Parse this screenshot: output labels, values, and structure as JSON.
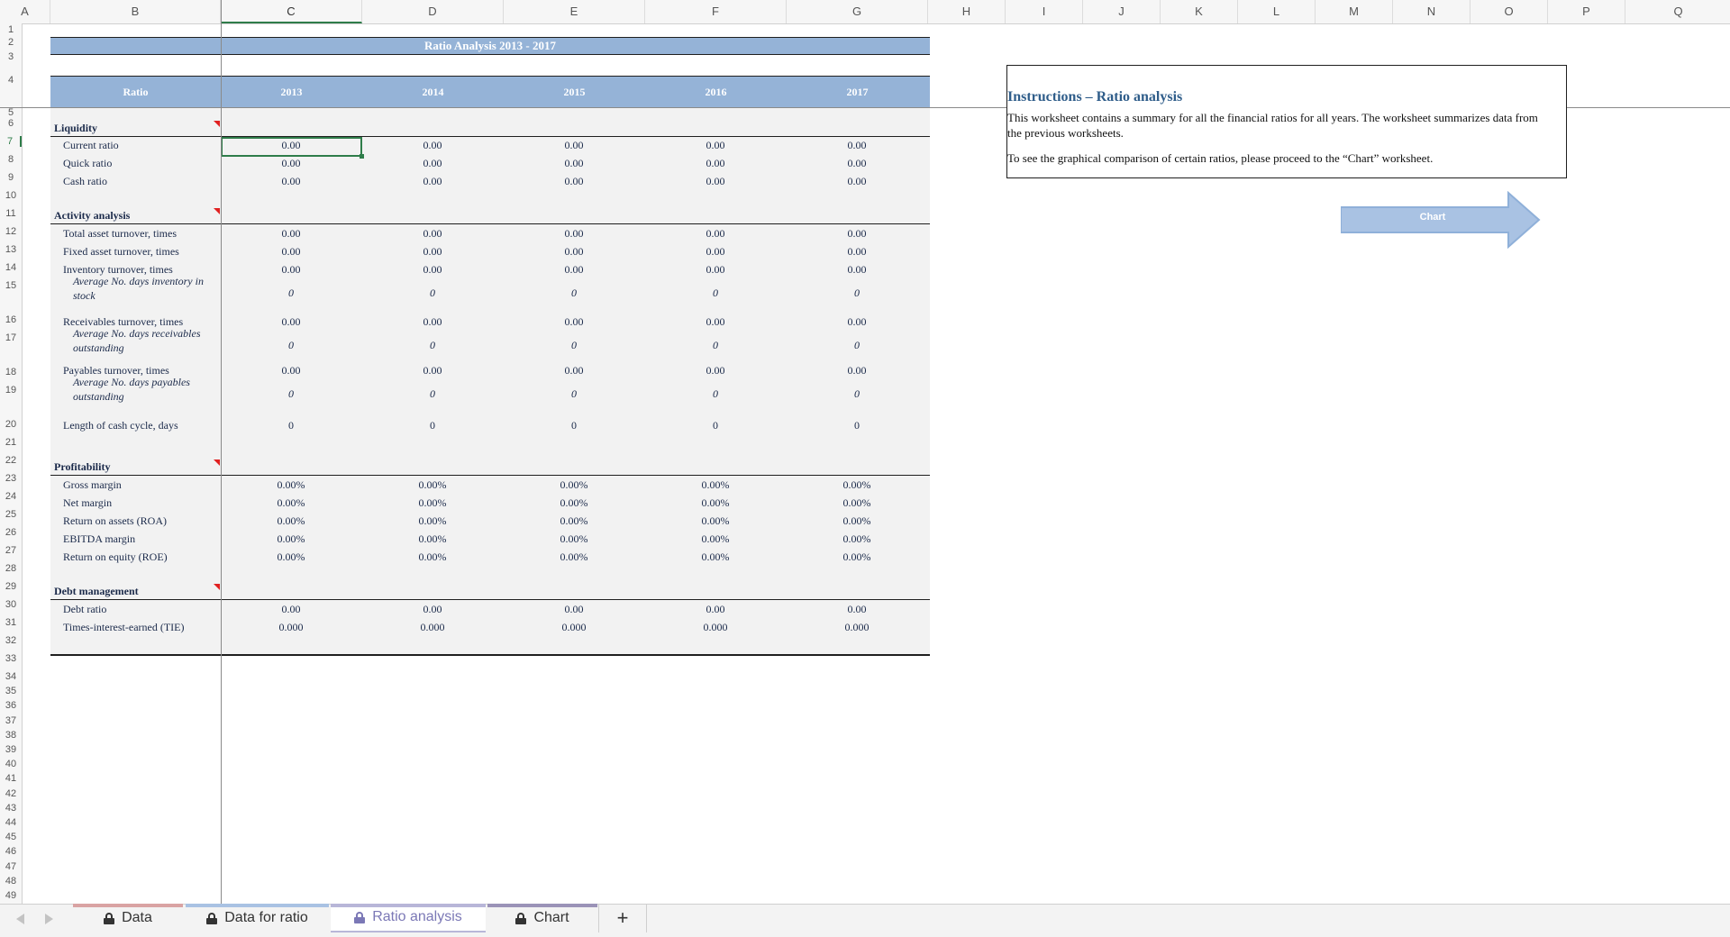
{
  "columns": [
    "A",
    "B",
    "C",
    "D",
    "E",
    "F",
    "G",
    "H",
    "I",
    "J",
    "K",
    "L",
    "M",
    "N",
    "O",
    "P",
    "Q"
  ],
  "rows": [
    "1",
    "2",
    "3",
    "4",
    "5",
    "6",
    "7",
    "8",
    "9",
    "10",
    "11",
    "12",
    "13",
    "14",
    "15",
    "16",
    "17",
    "18",
    "19",
    "20",
    "21",
    "22",
    "23",
    "24",
    "25",
    "26",
    "27",
    "28",
    "29",
    "30",
    "31",
    "32",
    "33",
    "34",
    "35",
    "36",
    "37",
    "38",
    "39",
    "40",
    "41",
    "42",
    "43",
    "44",
    "45",
    "46",
    "47",
    "48",
    "49"
  ],
  "selected_cell": "C7",
  "table": {
    "title": "Ratio Analysis 2013 - 2017",
    "header": {
      "ratio": "Ratio",
      "years": [
        "2013",
        "2014",
        "2015",
        "2016",
        "2017"
      ]
    },
    "sections": [
      {
        "name": "Liquidity",
        "rows": [
          {
            "label": "Current ratio",
            "values": [
              "0.00",
              "0.00",
              "0.00",
              "0.00",
              "0.00"
            ]
          },
          {
            "label": "Quick ratio",
            "values": [
              "0.00",
              "0.00",
              "0.00",
              "0.00",
              "0.00"
            ]
          },
          {
            "label": "Cash ratio",
            "values": [
              "0.00",
              "0.00",
              "0.00",
              "0.00",
              "0.00"
            ]
          }
        ]
      },
      {
        "name": "Activity analysis",
        "rows": [
          {
            "label": "Total asset turnover, times",
            "values": [
              "0.00",
              "0.00",
              "0.00",
              "0.00",
              "0.00"
            ]
          },
          {
            "label": "Fixed asset turnover, times",
            "values": [
              "0.00",
              "0.00",
              "0.00",
              "0.00",
              "0.00"
            ]
          },
          {
            "label": "Inventory turnover, times",
            "values": [
              "0.00",
              "0.00",
              "0.00",
              "0.00",
              "0.00"
            ]
          },
          {
            "label": "Average No. days inventory in stock",
            "values": [
              "0",
              "0",
              "0",
              "0",
              "0"
            ],
            "italic": true
          },
          {
            "label": "Receivables turnover, times",
            "values": [
              "0.00",
              "0.00",
              "0.00",
              "0.00",
              "0.00"
            ]
          },
          {
            "label": "Average No. days receivables outstanding",
            "values": [
              "0",
              "0",
              "0",
              "0",
              "0"
            ],
            "italic": true
          },
          {
            "label": "Payables turnover, times",
            "values": [
              "0.00",
              "0.00",
              "0.00",
              "0.00",
              "0.00"
            ]
          },
          {
            "label": "Average No. days payables outstanding",
            "values": [
              "0",
              "0",
              "0",
              "0",
              "0"
            ],
            "italic": true
          },
          {
            "label": "Length of cash cycle, days",
            "values": [
              "0",
              "0",
              "0",
              "0",
              "0"
            ]
          }
        ]
      },
      {
        "name": "Profitability",
        "rows": [
          {
            "label": "Gross margin",
            "values": [
              "0.00%",
              "0.00%",
              "0.00%",
              "0.00%",
              "0.00%"
            ]
          },
          {
            "label": "Net margin",
            "values": [
              "0.00%",
              "0.00%",
              "0.00%",
              "0.00%",
              "0.00%"
            ]
          },
          {
            "label": "Return on assets (ROA)",
            "values": [
              "0.00%",
              "0.00%",
              "0.00%",
              "0.00%",
              "0.00%"
            ]
          },
          {
            "label": "EBITDA margin",
            "values": [
              "0.00%",
              "0.00%",
              "0.00%",
              "0.00%",
              "0.00%"
            ]
          },
          {
            "label": "Return on equity (ROE)",
            "values": [
              "0.00%",
              "0.00%",
              "0.00%",
              "0.00%",
              "0.00%"
            ]
          }
        ]
      },
      {
        "name": "Debt management",
        "rows": [
          {
            "label": "Debt ratio",
            "values": [
              "0.00",
              "0.00",
              "0.00",
              "0.00",
              "0.00"
            ]
          },
          {
            "label": "Times-interest-earned (TIE)",
            "values": [
              "0.000",
              "0.000",
              "0.000",
              "0.000",
              "0.000"
            ]
          }
        ]
      }
    ]
  },
  "instructions": {
    "title": "Instructions – Ratio analysis",
    "line1": "This worksheet contains a summary for all the financial ratios for all years. The worksheet summarizes data from the previous worksheets.",
    "line2": "To see the graphical comparison of certain ratios, please proceed to the “Chart” worksheet."
  },
  "chart_button": {
    "label": "Chart",
    "color": "#a9c2e3"
  },
  "tabs": [
    {
      "label": "Data",
      "color": "#d9a3a3",
      "active": false,
      "icon": "lock-icon"
    },
    {
      "label": "Data for ratio",
      "color": "#a9c2e3",
      "active": false,
      "icon": "lock-icon"
    },
    {
      "label": "Ratio analysis",
      "color": "#b8b6d8",
      "active": true,
      "icon": "lock-icon"
    },
    {
      "label": "Chart",
      "color": "#9b93b8",
      "active": false,
      "icon": "lock-icon"
    }
  ],
  "add_tab_label": "+"
}
